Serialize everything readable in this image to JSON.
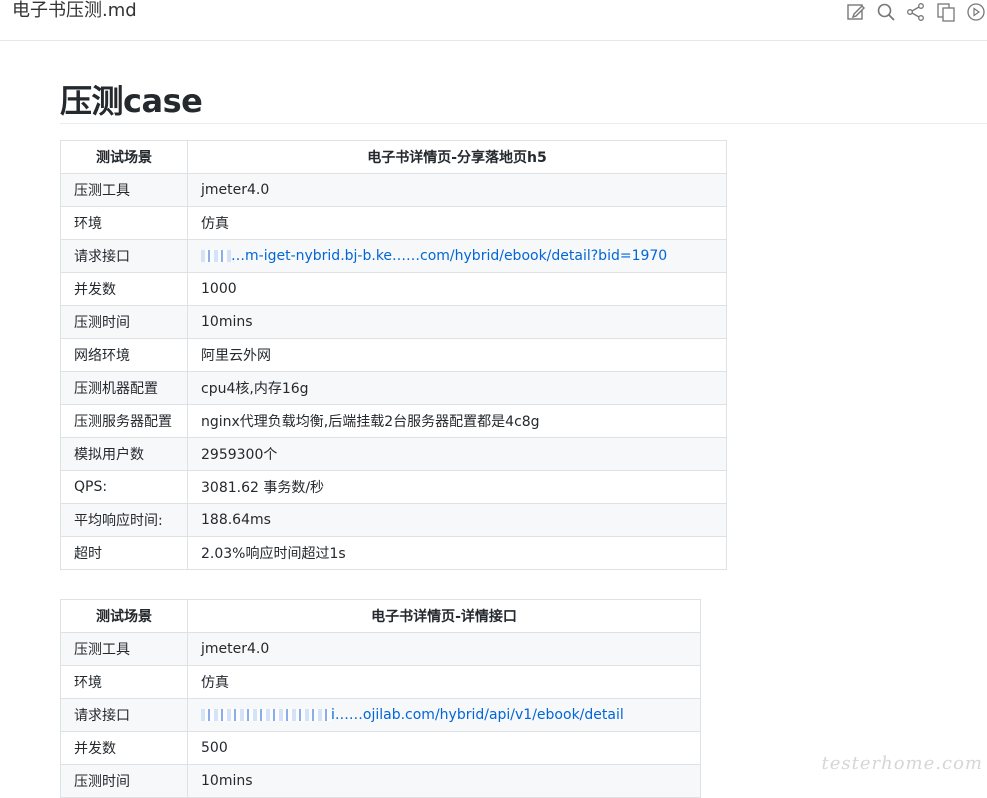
{
  "window": {
    "title": "电子书压测.md"
  },
  "toolbar": {
    "icons": [
      "edit-icon",
      "search-icon",
      "share-icon",
      "copy-icon",
      "play-icon"
    ]
  },
  "document": {
    "heading": "压测case",
    "tables": [
      {
        "header": [
          "测试场景",
          "电子书详情页-分享落地页h5"
        ],
        "rows": [
          [
            "压测工具",
            "jmeter4.0"
          ],
          [
            "环境",
            "仿真"
          ],
          [
            "请求接口",
            "…m-iget-nybrid.bj-b.ke……com/hybrid/ebook/detail?bid=1970"
          ],
          [
            "并发数",
            "1000"
          ],
          [
            "压测时间",
            "10mins"
          ],
          [
            "网络环境",
            "阿里云外网"
          ],
          [
            "压测机器配置",
            "cpu4核,内存16g"
          ],
          [
            "压测服务器配置",
            "nginx代理负载均衡,后端挂载2台服务器配置都是4c8g"
          ],
          [
            "模拟用户数",
            "2959300个"
          ],
          [
            "QPS:",
            "3081.62 事务数/秒"
          ],
          [
            "平均响应时间:",
            "188.64ms"
          ],
          [
            "超时",
            "2.03%响应时间超过1s"
          ]
        ]
      },
      {
        "header": [
          "测试场景",
          "电子书详情页-详情接口"
        ],
        "rows": [
          [
            "压测工具",
            "jmeter4.0"
          ],
          [
            "环境",
            "仿真"
          ],
          [
            "请求接口",
            "i……ojilab.com/hybrid/api/v1/ebook/detail"
          ],
          [
            "并发数",
            "500"
          ],
          [
            "压测时间",
            "10mins"
          ]
        ]
      }
    ]
  },
  "watermark": "testerhome.com"
}
